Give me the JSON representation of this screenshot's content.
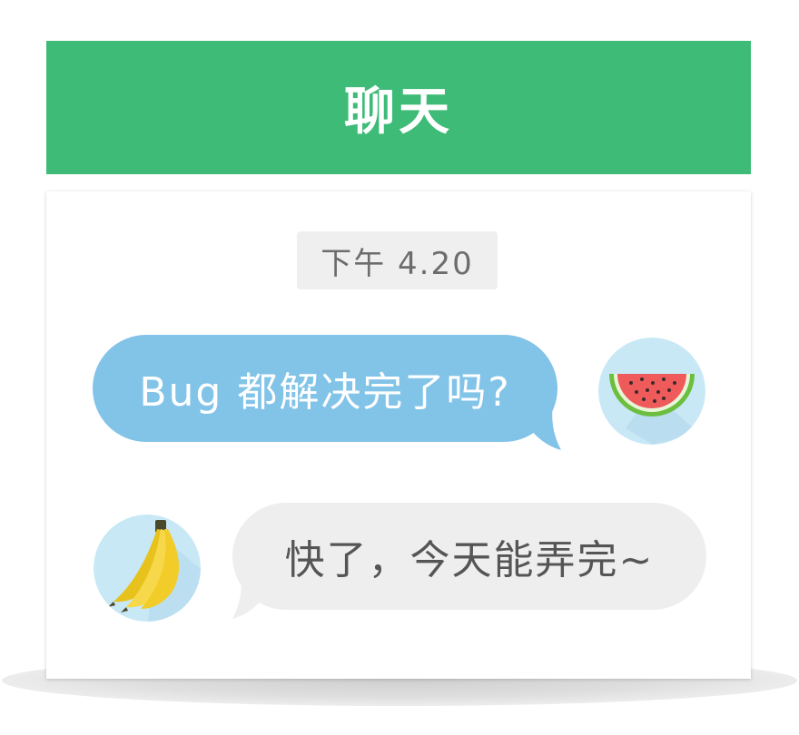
{
  "header": {
    "title": "聊天"
  },
  "chat": {
    "timestamp": "下午 4.20",
    "messages": [
      {
        "side": "right",
        "text": "Bug 都解决完了吗?",
        "avatar_icon": "watermelon-icon"
      },
      {
        "side": "left",
        "text": "快了，今天能弄完~",
        "avatar_icon": "banana-icon"
      }
    ]
  },
  "colors": {
    "header_bg": "#3dbb77",
    "right_bubble": "#82c3e8",
    "left_bubble": "#eeeeee",
    "avatar_bg": "#c8e8f6"
  }
}
